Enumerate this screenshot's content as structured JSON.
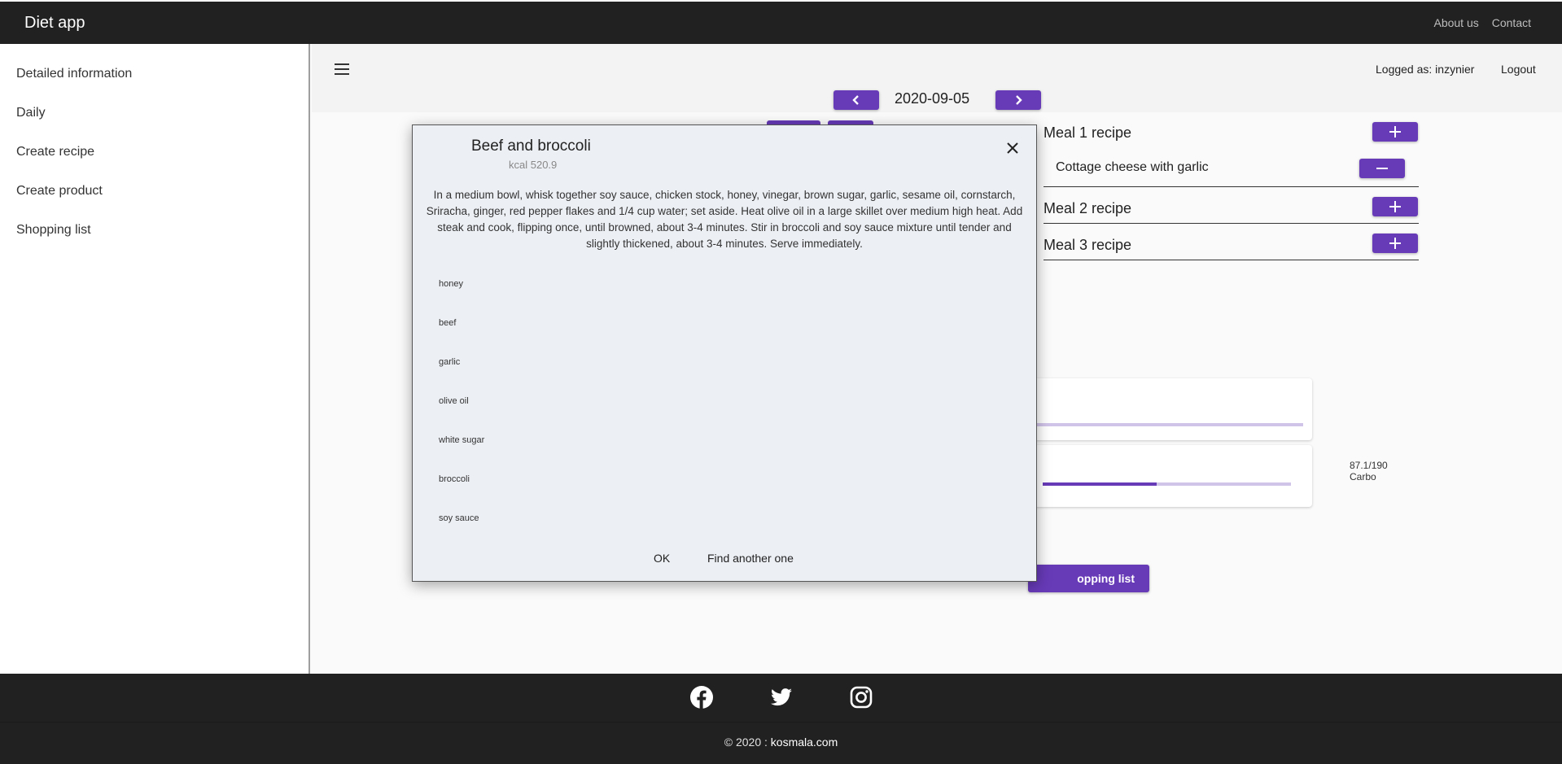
{
  "app": {
    "title": "Diet app"
  },
  "topnav": {
    "about": "About us",
    "contact": "Contact"
  },
  "sidebar": {
    "items": [
      {
        "label": "Detailed information"
      },
      {
        "label": "Daily"
      },
      {
        "label": "Create recipe"
      },
      {
        "label": "Create product"
      },
      {
        "label": "Shopping list"
      }
    ]
  },
  "header": {
    "user": "Logged as: inzynier",
    "logout": "Logout"
  },
  "date": {
    "value": "2020-09-05"
  },
  "meals": [
    {
      "label": "Meal 1 recipe",
      "recipes": [
        "Cottage cheese with garlic"
      ]
    },
    {
      "label": "Meal 2 recipe"
    },
    {
      "label": "Meal 3 recipe"
    }
  ],
  "nutrition": {
    "carbo": {
      "label": "87.1/190 Carbo",
      "current": 87.1,
      "target": 190
    }
  },
  "shopping": {
    "button_label": "opping list"
  },
  "dialog": {
    "title": "Beef and broccoli",
    "kcal": "kcal 520.9",
    "description": "In a medium bowl, whisk together soy sauce, chicken stock, honey, vinegar, brown sugar, garlic, sesame oil, cornstarch, Sriracha, ginger, red pepper flakes and 1/4 cup water; set aside. Heat olive oil in a large skillet over medium high heat. Add steak and cook, flipping once, until browned, about 3-4 minutes. Stir in broccoli and soy sauce mixture until tender and slightly thickened, about 3-4 minutes. Serve immediately.",
    "ingredients": [
      "honey",
      "beef",
      "garlic",
      "olive oil",
      "white sugar",
      "broccoli",
      "soy sauce"
    ],
    "ok": "OK",
    "find_another": "Find another one"
  },
  "footer": {
    "copyright_prefix": "© 2020 : ",
    "site": "kosmala.com"
  },
  "colors": {
    "primary": "#673ab7",
    "primary_light": "#d1c4e9",
    "dark": "#212121"
  },
  "icons": [
    "menu-icon",
    "chevron-left-icon",
    "chevron-right-icon",
    "plus-icon",
    "minus-icon",
    "close-icon",
    "facebook-icon",
    "twitter-icon",
    "instagram-icon"
  ]
}
